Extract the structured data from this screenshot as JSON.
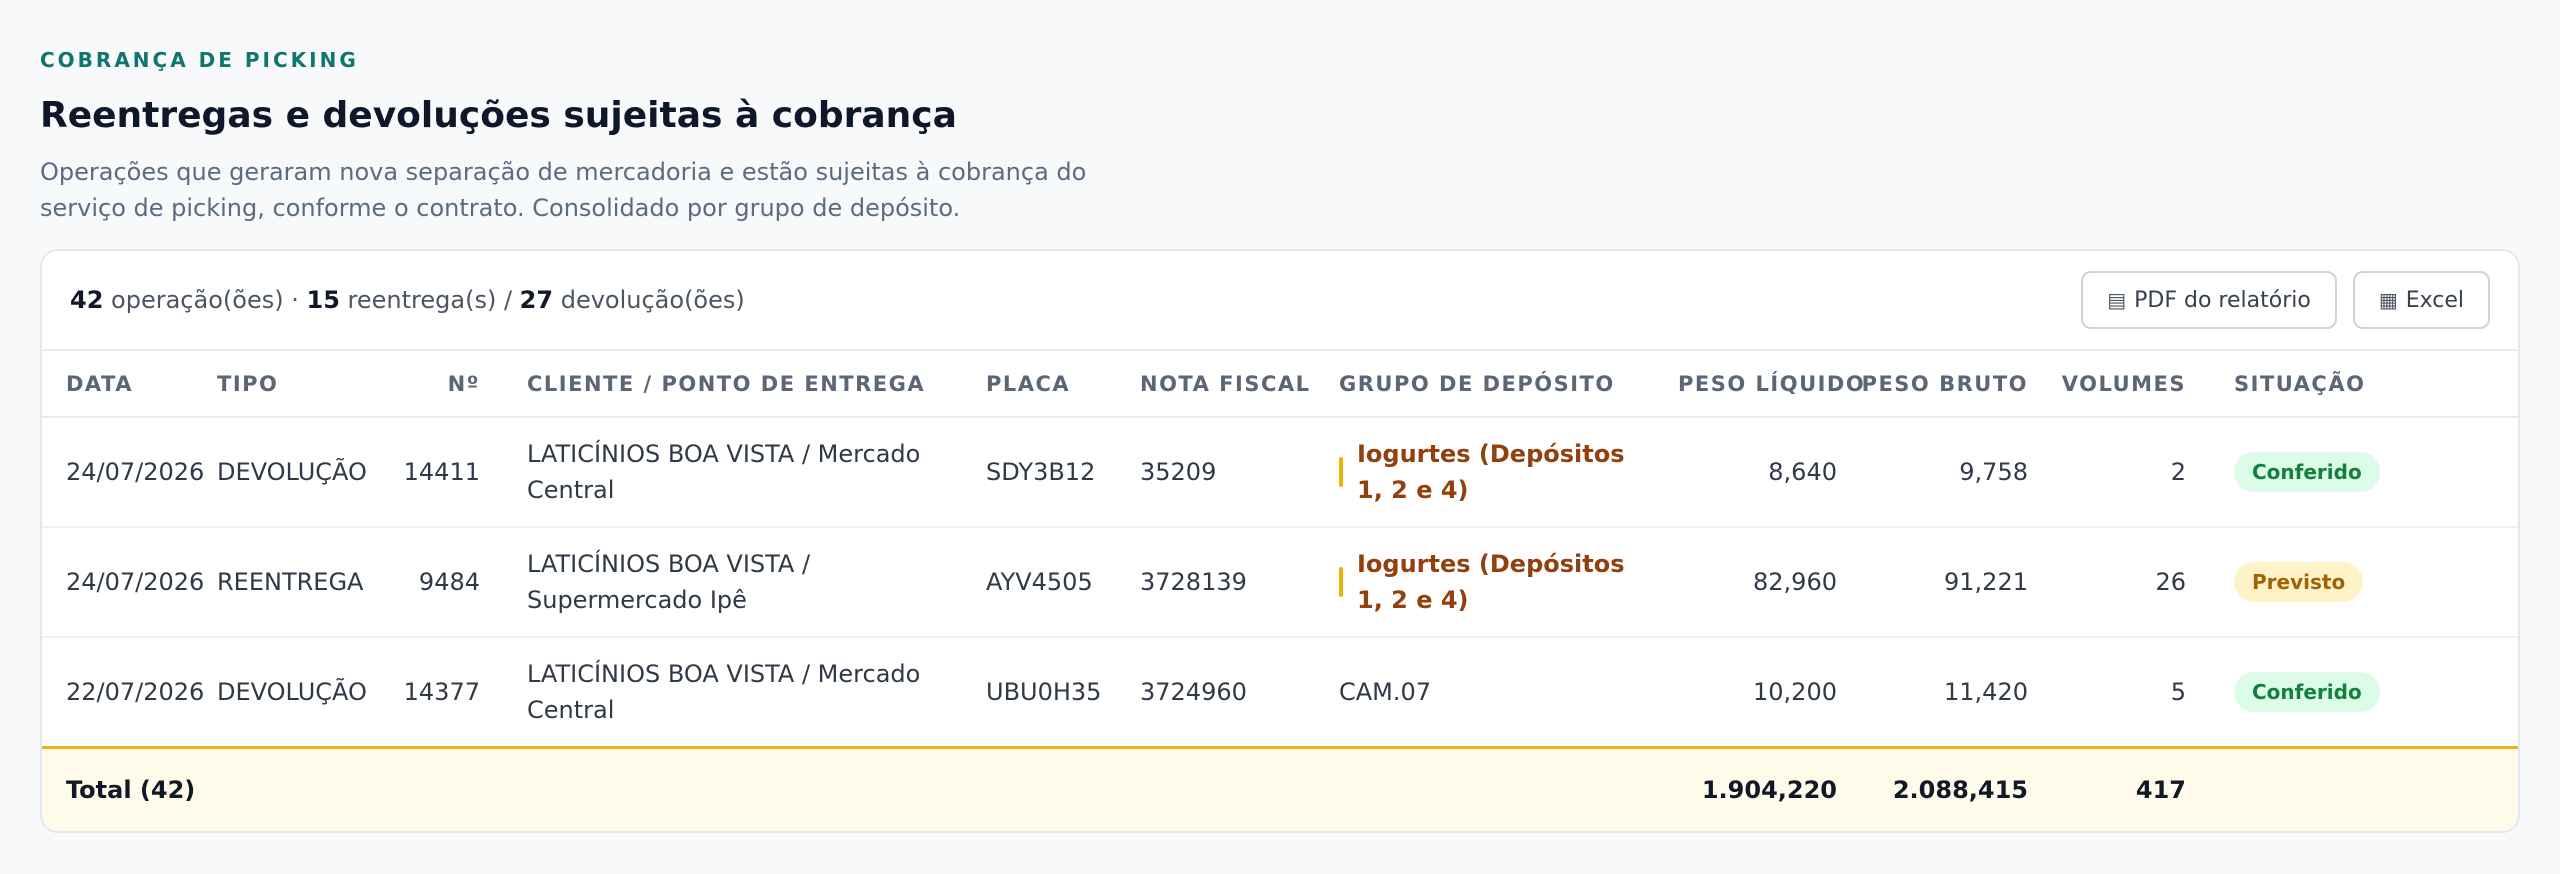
{
  "header": {
    "eyebrow": "COBRANÇA DE PICKING",
    "title": "Reentregas e devoluções sujeitas à cobrança",
    "subtitle": "Operações que geraram nova separação de mercadoria e estão sujeitas à cobrança do serviço de picking, conforme o contrato. Consolidado por grupo de depósito."
  },
  "summary": {
    "operations": "42",
    "operations_label": "operação(ões)",
    "separator": "·",
    "reentregas": "15",
    "reentregas_label": "reentrega(s) /",
    "devolucoes": "27",
    "devolucoes_label": "devolução(ões)"
  },
  "actions": {
    "pdf_icon": "▤",
    "pdf_label": "PDF do relatório",
    "excel_icon": "▦",
    "excel_label": "Excel"
  },
  "table": {
    "columns": {
      "data": "DATA",
      "tipo": "TIPO",
      "numero": "Nº",
      "cliente": "CLIENTE / PONTO DE ENTREGA",
      "placa": "PLACA",
      "nota": "NOTA FISCAL",
      "grupo": "GRUPO DE DEPÓSITO",
      "peso_liquido": "PESO LÍQUIDO",
      "peso_bruto": "PESO BRUTO",
      "volumes": "VOLUMES",
      "situacao": "SITUAÇÃO"
    },
    "rows": [
      {
        "data": "24/07/2026",
        "tipo": "DEVOLUÇÃO",
        "numero": "14411",
        "cliente": "LATICÍNIOS BOA VISTA / Mercado Central",
        "placa": "SDY3B12",
        "nota": "35209",
        "grupo": "Iogurtes (Depósitos 1, 2 e 4)",
        "peso_liquido": "8,640",
        "peso_bruto": "9,758",
        "volumes": "2",
        "situacao": "Conferido"
      },
      {
        "data": "24/07/2026",
        "tipo": "REENTREGA",
        "numero": "9484",
        "cliente": "LATICÍNIOS BOA VISTA / Supermercado Ipê",
        "placa": "AYV4505",
        "nota": "3728139",
        "grupo": "Iogurtes (Depósitos 1, 2 e 4)",
        "peso_liquido": "82,960",
        "peso_bruto": "91,221",
        "volumes": "26",
        "situacao": "Previsto"
      },
      {
        "data": "22/07/2026",
        "tipo": "DEVOLUÇÃO",
        "numero": "14377",
        "cliente": "LATICÍNIOS BOA VISTA / Mercado Central",
        "placa": "UBU0H35",
        "nota": "3724960",
        "grupo": "CAM.07",
        "peso_liquido": "10,200",
        "peso_bruto": "11,420",
        "volumes": "5",
        "situacao": "Conferido"
      }
    ],
    "total": {
      "label": "Total (42)",
      "peso_liquido": "1.904,220",
      "peso_bruto": "2.088,415",
      "volumes": "417"
    }
  },
  "colors": {
    "accent": "#0f766e",
    "group_highlight": "#92400e",
    "group_bar": "#eab308",
    "status_ok_bg": "#dcfce7",
    "status_ok_text": "#15803d",
    "status_prev_bg": "#fef3c7",
    "status_prev_text": "#a16207",
    "total_bg": "#fffbea",
    "total_border": "#f1b414"
  }
}
